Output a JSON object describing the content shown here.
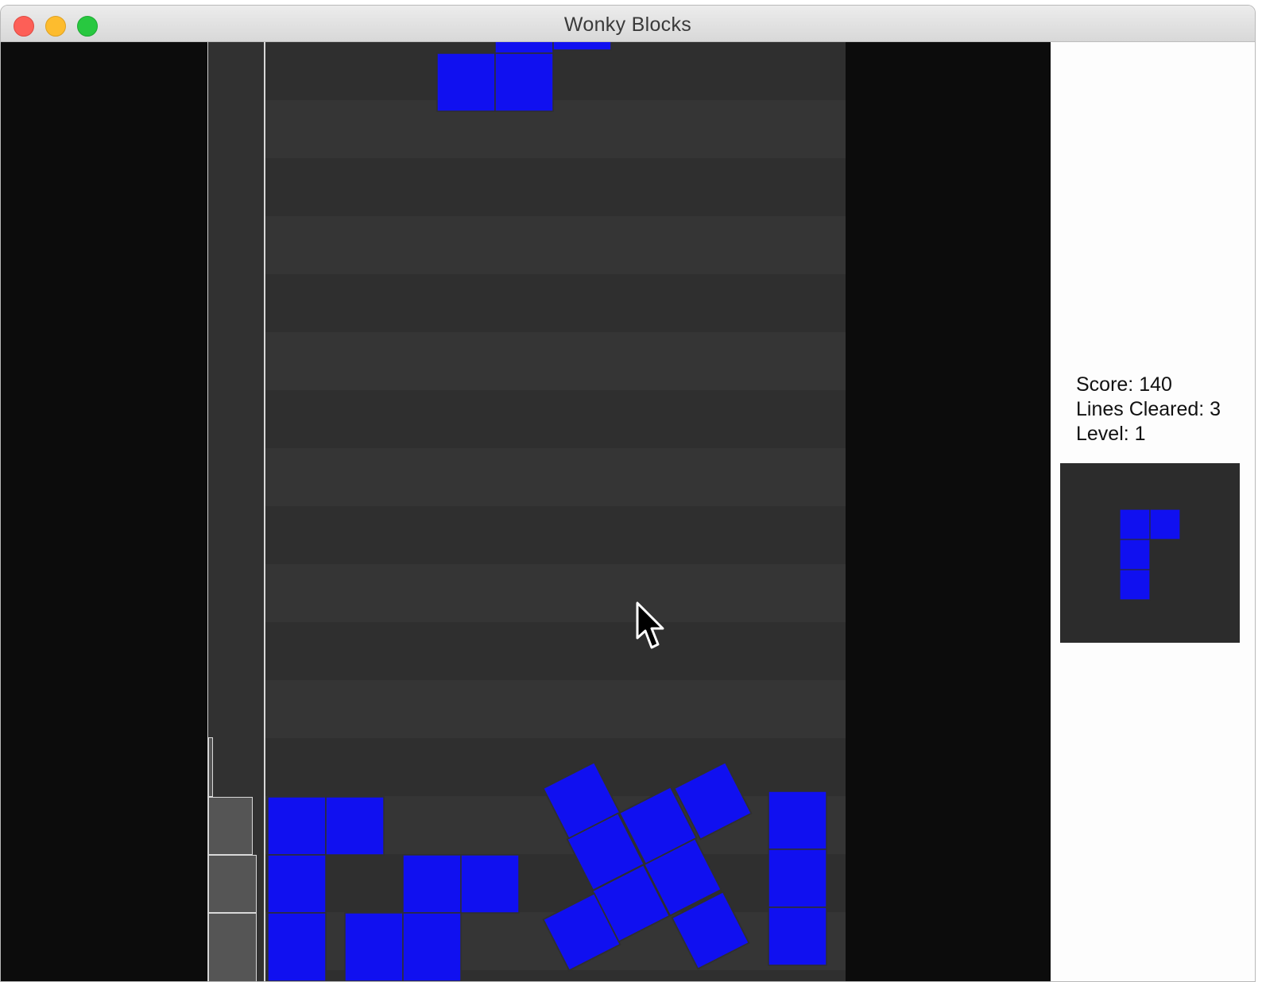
{
  "window": {
    "title": "Wonky Blocks"
  },
  "stats": {
    "score_label": "Score: 140",
    "lines_label": "Lines Cleared: 3",
    "level_label": "Level: 1"
  },
  "colors": {
    "block": "#1010f0",
    "board_bg": "#2f2f2f",
    "board_row_alt": "#343434",
    "outer_bg": "#0c0c0c",
    "gutter_block": "#555555"
  },
  "icons": [
    "close-button",
    "minimize-button",
    "maximize-button",
    "mouse-cursor"
  ]
}
